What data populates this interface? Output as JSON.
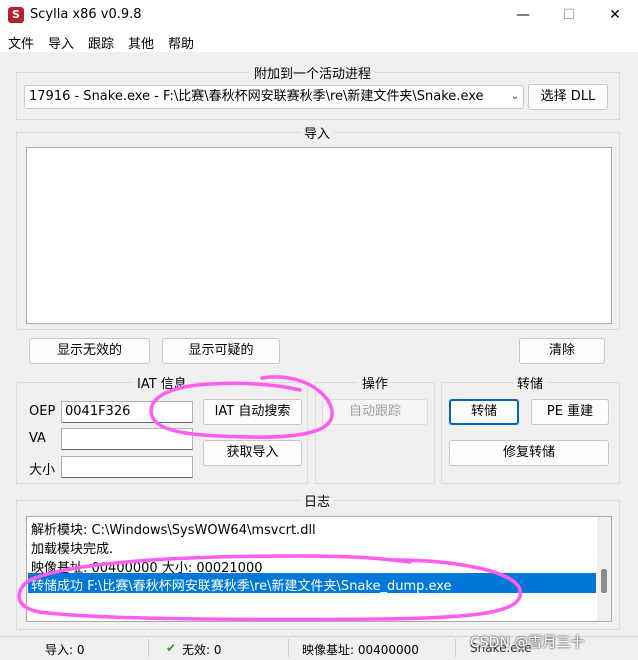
{
  "window": {
    "title": "Scylla x86 v0.9.8",
    "icon_letter": "S"
  },
  "menu": [
    "文件",
    "导入",
    "跟踪",
    "其他",
    "帮助"
  ],
  "attach": {
    "title": "附加到一个活动进程",
    "process": "17916 - Snake.exe - F:\\比赛\\春秋杯网安联赛秋季\\re\\新建文件夹\\Snake.exe",
    "pick_dll": "选择 DLL"
  },
  "imports": {
    "title": "导入"
  },
  "import_buttons": {
    "show_invalid": "显示无效的",
    "show_suspect": "显示可疑的",
    "clear": "清除"
  },
  "iat": {
    "title": "IAT 信息",
    "oep_label": "OEP",
    "oep_value": "0041F326",
    "va_label": "VA",
    "va_value": "",
    "size_label": "大小",
    "size_value": "",
    "autosearch": "IAT 自动搜索",
    "get_imports": "获取导入"
  },
  "actions": {
    "title": "操作",
    "autotrace": "自动跟踪"
  },
  "dump": {
    "title": "转储",
    "dump": "转储",
    "pe_rebuild": "PE 重建",
    "fix_dump": "修复转储"
  },
  "log": {
    "title": "日志",
    "lines": [
      "解析模块: C:\\Windows\\SysWOW64\\msvcrt.dll",
      "加载模块完成.",
      "映像基址: 00400000 大小: 00021000",
      "转储成功 F:\\比赛\\春秋杯网安联赛秋季\\re\\新建文件夹\\Snake_dump.exe"
    ]
  },
  "status": {
    "imports": "导入: 0",
    "invalid": "无效: 0",
    "imagebase": "映像基址: 00400000",
    "module": "Snake.exe"
  },
  "watermark": "CSDN @雪月三十",
  "colors": {
    "selection": "#0078d7",
    "annotation": "#ff5cf0"
  }
}
